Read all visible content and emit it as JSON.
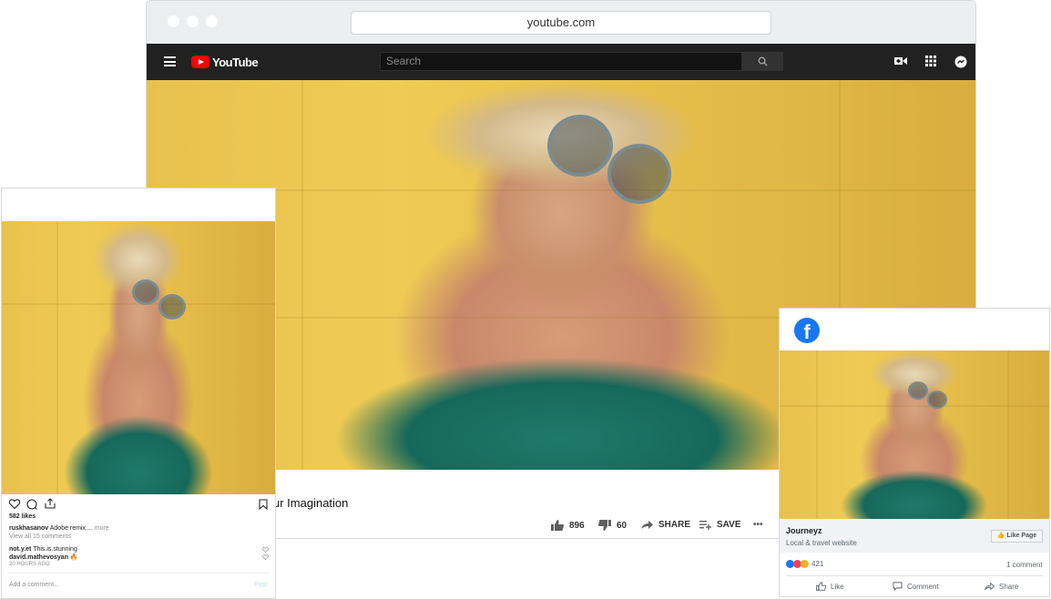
{
  "browser": {
    "url": "youtube.com"
  },
  "youtube": {
    "logo_text": "YouTube",
    "search_placeholder": "Search",
    "video_title": "ur Imagination",
    "likes": "896",
    "dislikes": "60",
    "share_label": "SHARE",
    "save_label": "SAVE",
    "more_label": "•••"
  },
  "instagram": {
    "likes": "582 likes",
    "caption_user": "ruskhasanov",
    "caption_text": "Adobe remix.... ",
    "caption_more": "more",
    "view_comments": "View all 15 comments",
    "comments": [
      {
        "user": "not.y.et",
        "text": "This.is.stunning"
      },
      {
        "user": "david.mathevosyan",
        "text": "🔥"
      }
    ],
    "time_ago": "20 HOURS AGO",
    "add_comment_placeholder": "Add a comment...",
    "post_label": "Post"
  },
  "facebook": {
    "page_name": "Journeyz",
    "page_category": "Local & travel website",
    "like_page_label": "Like Page",
    "reaction_count": "421",
    "comment_count": "1 comment",
    "actions": {
      "like": "Like",
      "comment": "Comment",
      "share": "Share"
    }
  },
  "colors": {
    "youtube_red": "#ff0000",
    "youtube_bar": "#212121",
    "facebook_blue": "#1877f2"
  }
}
